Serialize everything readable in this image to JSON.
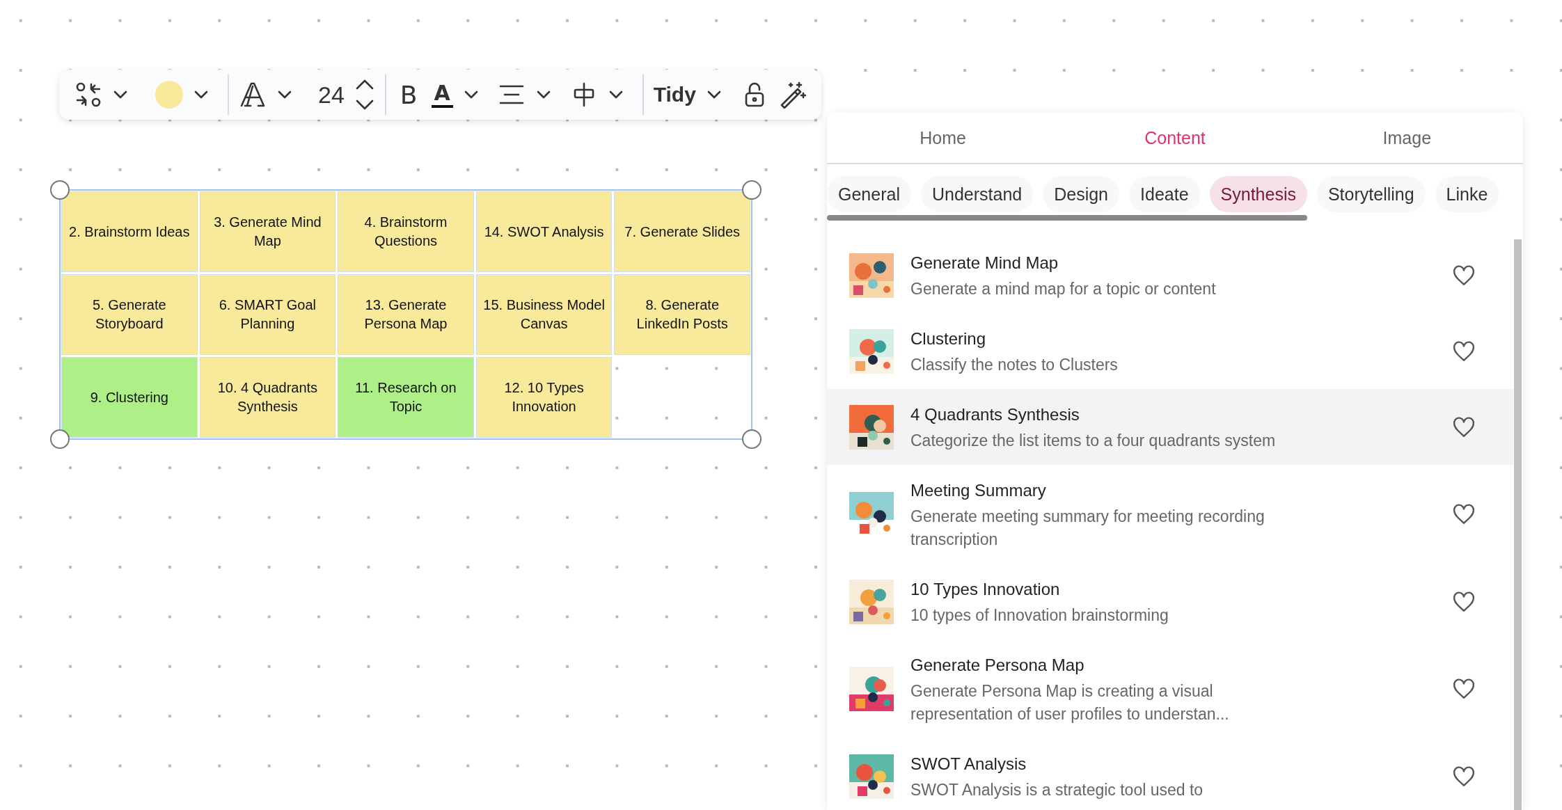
{
  "toolbar": {
    "swatch": {
      "color": "#f8e99b"
    },
    "font_size": "24",
    "bold": "B",
    "text_color": "A",
    "layout": "Tidy"
  },
  "notes": [
    {
      "text": "2. Brainstorm Ideas",
      "color": "#f8e99b"
    },
    {
      "text": "3. Generate Mind Map",
      "color": "#f8e99b"
    },
    {
      "text": "4. Brainstorm Questions",
      "color": "#f8e99b"
    },
    {
      "text": "14. SWOT Analysis",
      "color": "#f8e99b"
    },
    {
      "text": "7. Generate Slides",
      "color": "#f8e99b"
    },
    {
      "text": "5. Generate Storyboard",
      "color": "#f8e99b"
    },
    {
      "text": "6. SMART Goal Planning",
      "color": "#f8e99b"
    },
    {
      "text": "13. Generate Persona Map",
      "color": "#f8e99b"
    },
    {
      "text": "15. Business Model Canvas",
      "color": "#f8e99b"
    },
    {
      "text": "8. Generate LinkedIn Posts",
      "color": "#f8e99b"
    },
    {
      "text": "9. Clustering",
      "color": "#aef087"
    },
    {
      "text": "10. 4 Quadrants Synthesis",
      "color": "#f8e99b"
    },
    {
      "text": "11. Research on Topic",
      "color": "#aef087"
    },
    {
      "text": "12. 10 Types Innovation",
      "color": "#f8e99b"
    }
  ],
  "panel": {
    "tabs": [
      {
        "label": "Home",
        "selected": false
      },
      {
        "label": "Content",
        "selected": true
      },
      {
        "label": "Image",
        "selected": false
      }
    ],
    "categories": [
      {
        "label": "General",
        "selected": false
      },
      {
        "label": "Understand",
        "selected": false
      },
      {
        "label": "Design",
        "selected": false
      },
      {
        "label": "Ideate",
        "selected": false
      },
      {
        "label": "Synthesis",
        "selected": true
      },
      {
        "label": "Storytelling",
        "selected": false
      },
      {
        "label": "Linke",
        "selected": false
      }
    ],
    "items": [
      {
        "title": "Generate Mind Map",
        "description": "Generate a mind map for a topic or content",
        "hovered": false
      },
      {
        "title": "Clustering",
        "description": "Classify the notes to Clusters",
        "hovered": false
      },
      {
        "title": "4 Quadrants Synthesis",
        "description": "Categorize the list items to a four quadrants system",
        "hovered": true
      },
      {
        "title": "Meeting Summary",
        "description": "Generate meeting summary for meeting recording transcription",
        "hovered": false
      },
      {
        "title": "10 Types Innovation",
        "description": "10 types of Innovation brainstorming",
        "hovered": false
      },
      {
        "title": "Generate Persona Map",
        "description": "Generate Persona Map is creating a visual representation of user profiles to understan...",
        "hovered": false
      },
      {
        "title": "SWOT Analysis",
        "description": "SWOT Analysis is a strategic tool used to",
        "hovered": false
      }
    ]
  }
}
